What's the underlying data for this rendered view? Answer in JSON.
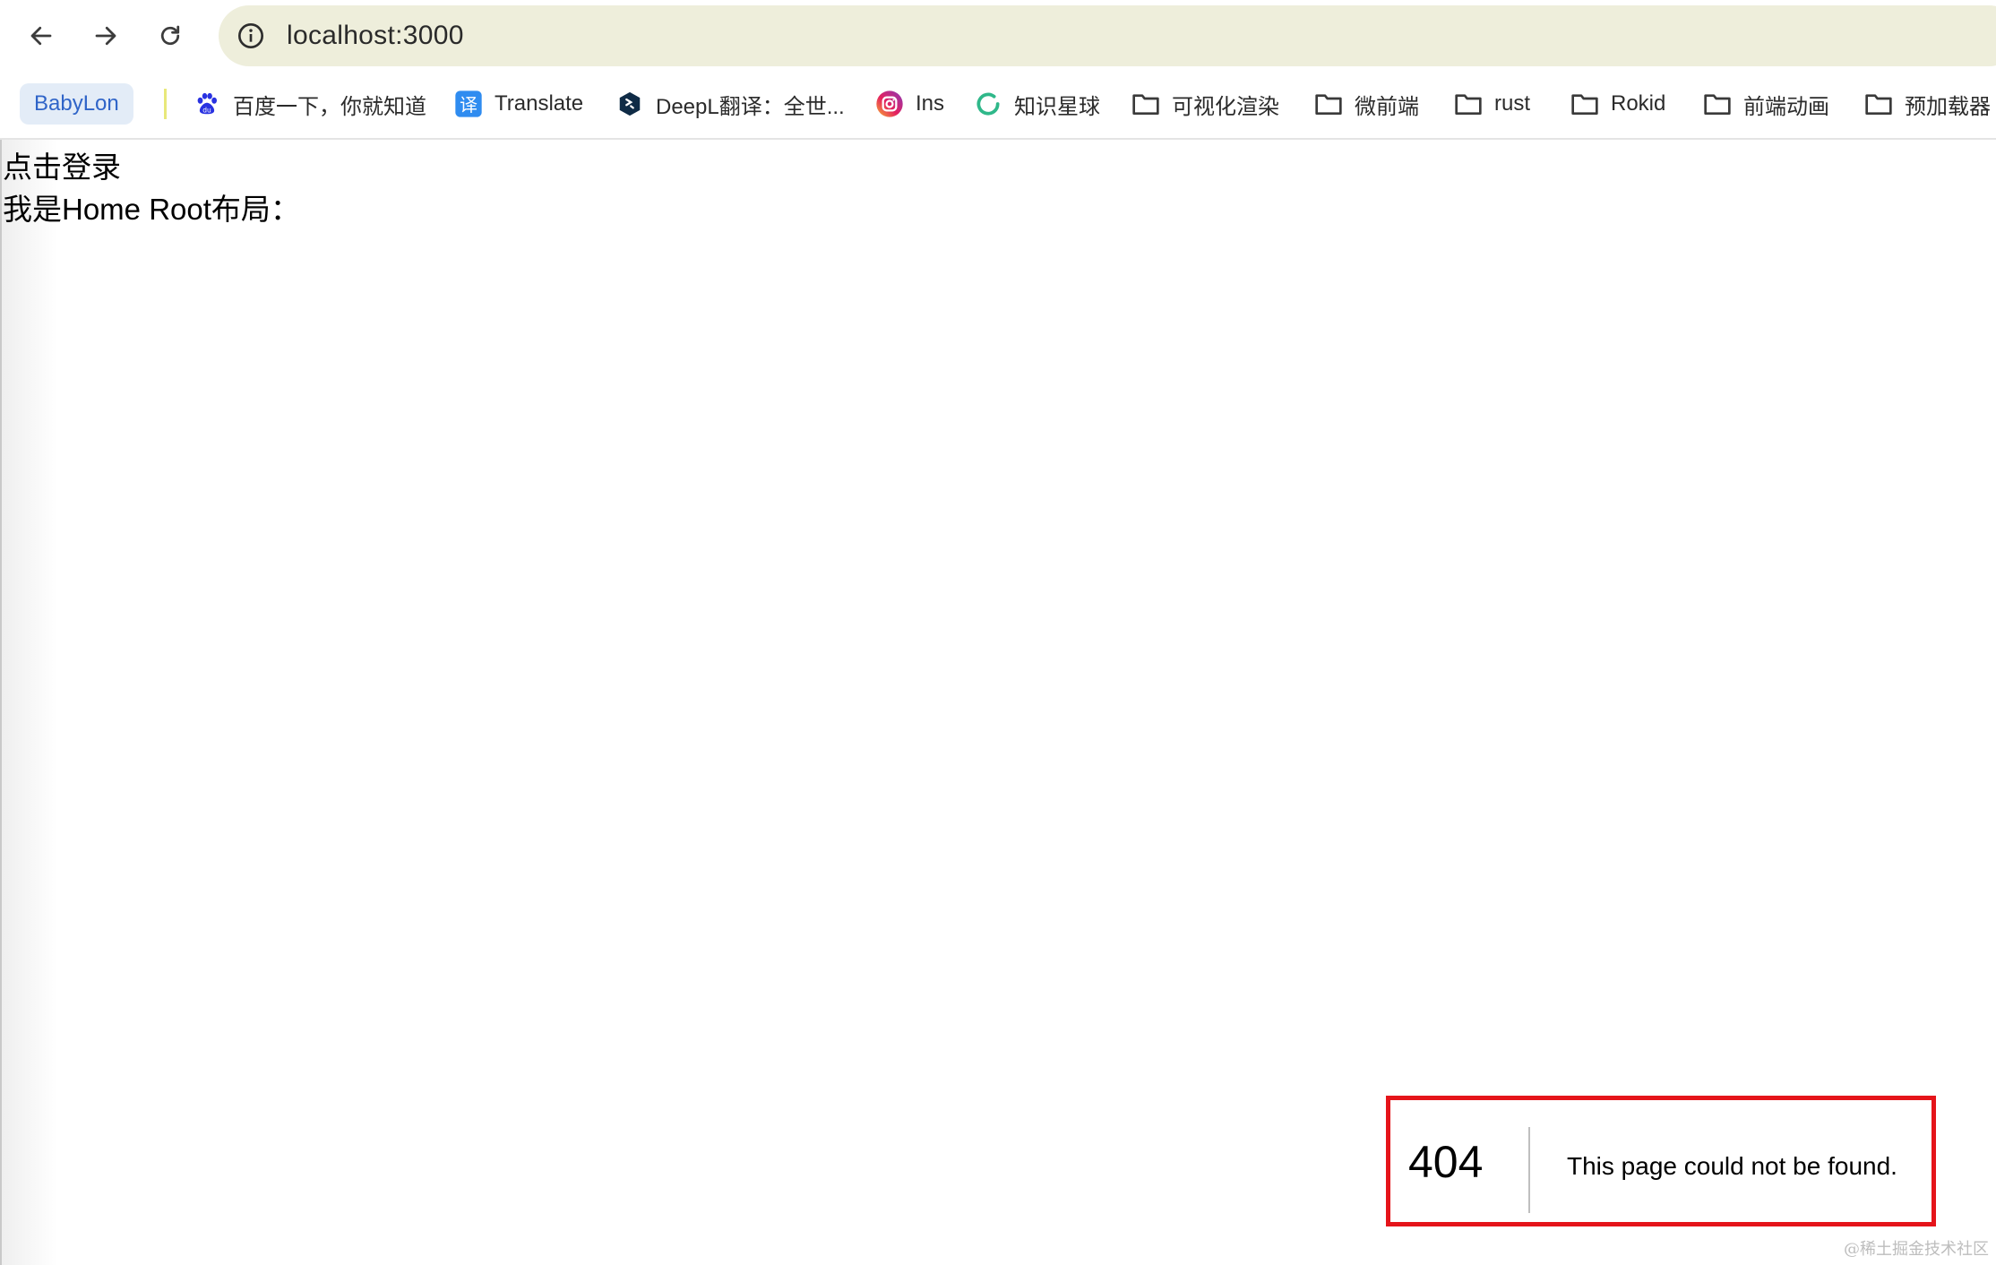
{
  "browser": {
    "url": "localhost:3000",
    "bookmarks": [
      {
        "label": "BabyLon",
        "icon": "none"
      },
      {
        "label": "百度一下，你就知道",
        "icon": "baidu-paw-icon"
      },
      {
        "label": "Translate",
        "icon": "translate-icon"
      },
      {
        "label": "DeepL翻译：全世...",
        "icon": "deepl-icon"
      },
      {
        "label": "Ins",
        "icon": "instagram-icon"
      },
      {
        "label": "知识星球",
        "icon": "knowledge-planet-icon"
      },
      {
        "label": "可视化渲染",
        "icon": "folder-icon"
      },
      {
        "label": "微前端",
        "icon": "folder-icon"
      },
      {
        "label": "rust",
        "icon": "folder-icon"
      },
      {
        "label": "Rokid",
        "icon": "folder-icon"
      },
      {
        "label": "前端动画",
        "icon": "folder-icon"
      },
      {
        "label": "预加载器",
        "icon": "folder-icon"
      }
    ]
  },
  "page": {
    "line1": "点击登录",
    "line2": "我是Home Root布局："
  },
  "not_found": {
    "code": "404",
    "message": "This page could not be found."
  },
  "watermark": "@稀土掘金技术社区",
  "colors": {
    "highlight_border": "#e5141a",
    "omnibox_bg": "#eeeedb",
    "bookmark_chip_bg": "#e3ecf7"
  }
}
